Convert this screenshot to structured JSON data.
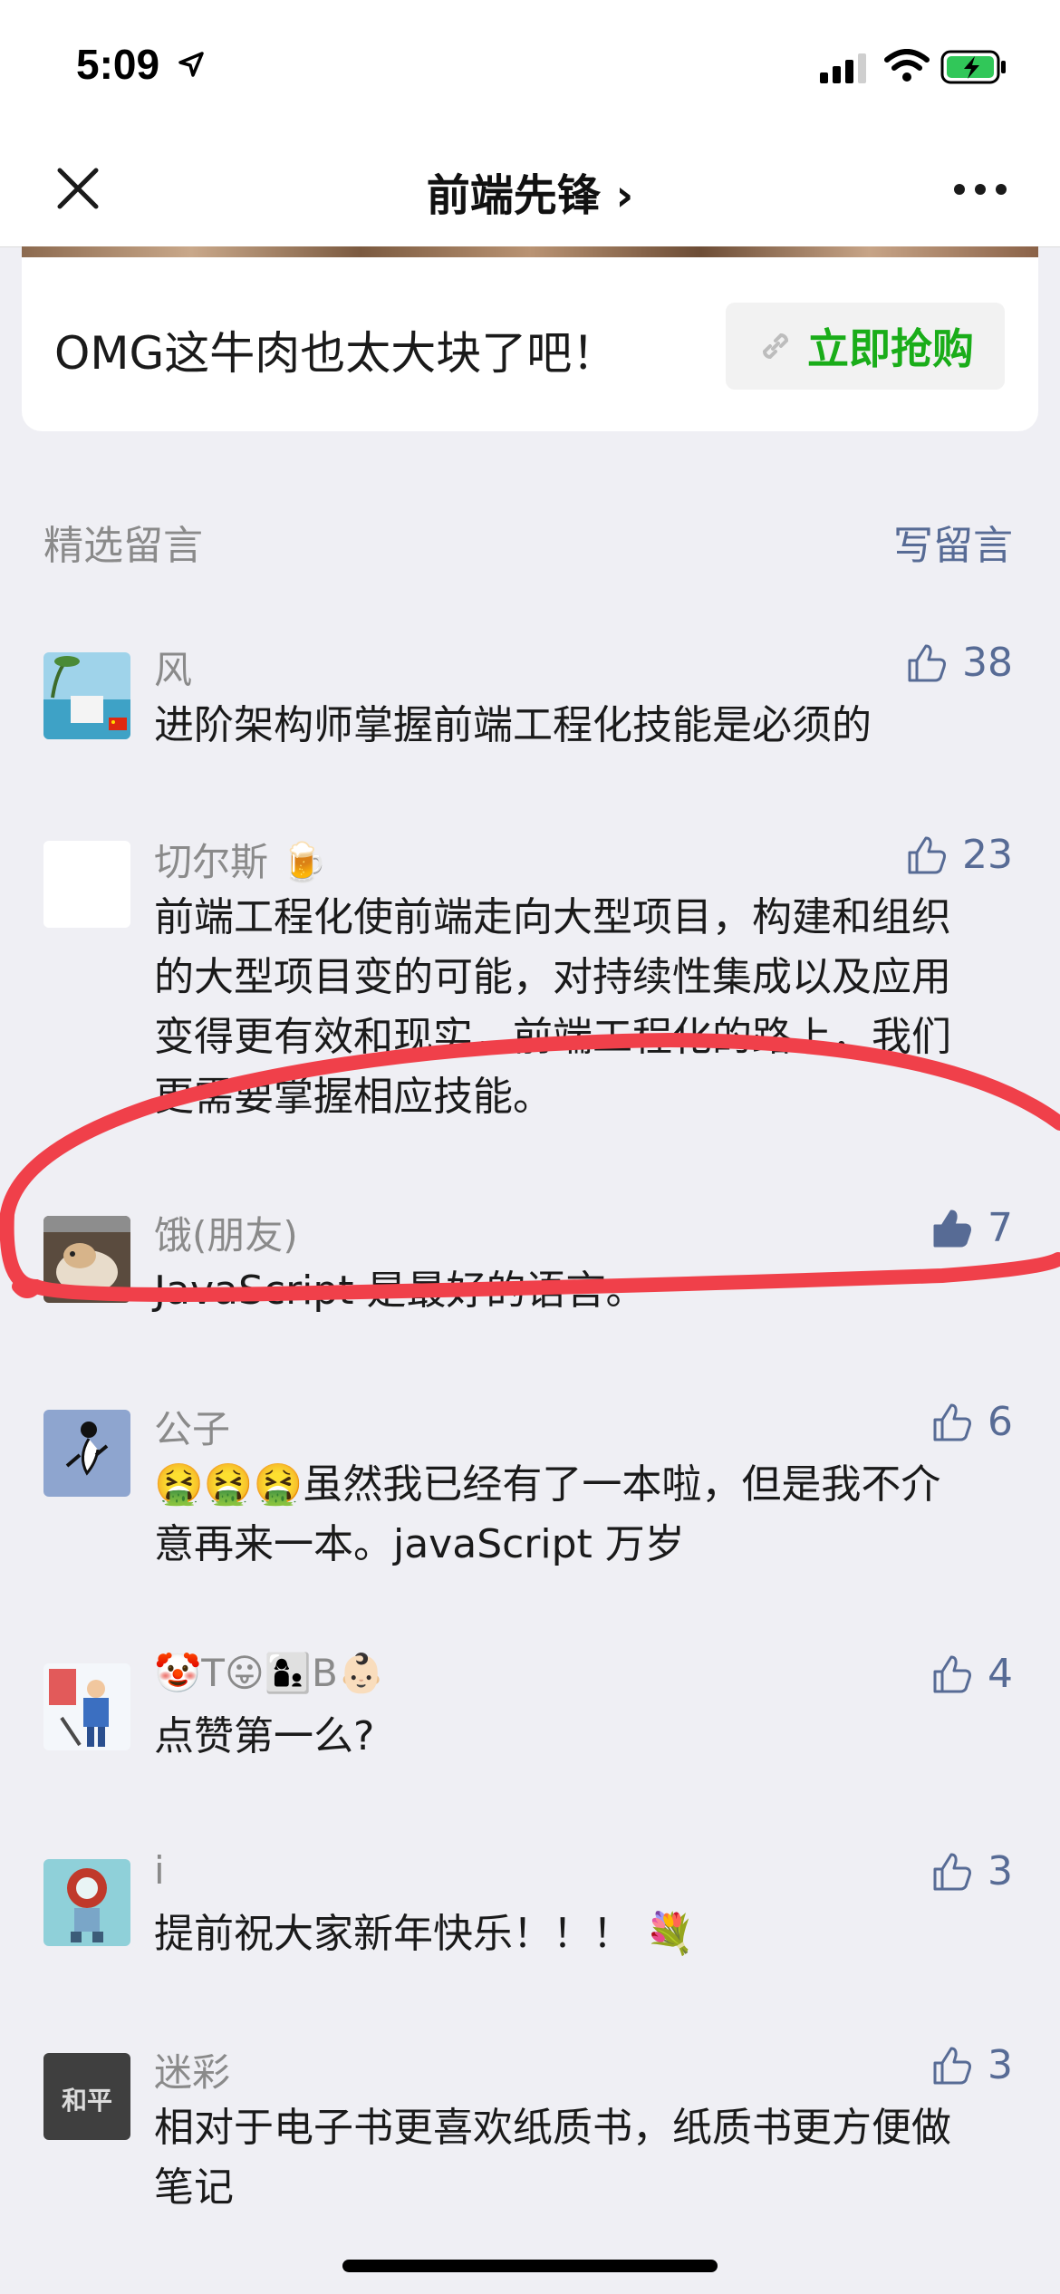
{
  "status": {
    "time": "5:09"
  },
  "nav": {
    "title": "前端先锋 ›"
  },
  "card": {
    "text": "OMG这牛肉也太大块了吧！",
    "button_label": "立即抢购"
  },
  "section": {
    "title": "精选留言",
    "write_link": "写留言"
  },
  "comments": [
    {
      "name": "风",
      "text": "进阶架构师掌握前端工程化技能是必须的",
      "likes": "38"
    },
    {
      "name": "切尔斯 🍺",
      "text": "前端工程化使前端走向大型项目，构建和组织的大型项目变的可能，对持续性集成以及应用变得更有效和现实，前端工程化的路上，我们更需要掌握相应技能。",
      "likes": "23"
    },
    {
      "name": "饿(朋友)",
      "text": "JavaScript 是最好的语言。",
      "likes": "7"
    },
    {
      "name": "公子",
      "text": "🤮🤮🤮虽然我已经有了一本啦，但是我不介意再来一本。javaScript 万岁",
      "likes": "6"
    },
    {
      "name": "🤡T😛👩‍👦B👶🏻",
      "text": "点赞第一么?",
      "likes": "4"
    },
    {
      "name": "i",
      "text": "提前祝大家新年快乐！！！ 💐",
      "likes": "3"
    },
    {
      "name": "迷彩",
      "text": "相对于电子书更喜欢纸质书，纸质书更方便做笔记",
      "likes": "3"
    }
  ],
  "avatars": {
    "mi_cai_text": "和平"
  },
  "colors": {
    "link_blue": "#576b95",
    "buy_green": "#1aad19",
    "annotation_red": "#f0404a",
    "background": "#efeff4"
  }
}
